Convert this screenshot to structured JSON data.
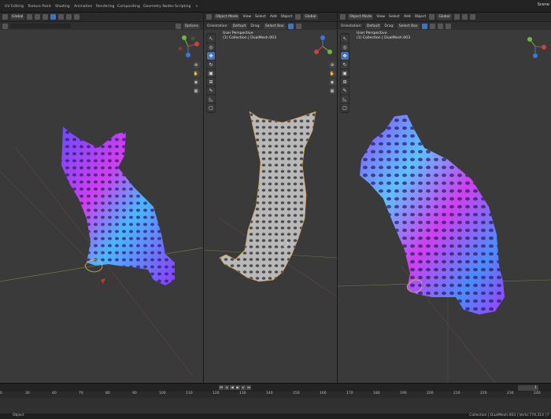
{
  "topbar": {
    "tabs": [
      "UV Editing",
      "Texture Paint",
      "Shading",
      "Animation",
      "Rendering",
      "Compositing",
      "Geometry Nodes",
      "Scripting",
      "+"
    ],
    "scene": "Scene"
  },
  "left": {
    "orientation": "Global",
    "options": "Options"
  },
  "middle": {
    "mode": "Object Mode",
    "menus": [
      "View",
      "Select",
      "Add",
      "Object"
    ],
    "transform": "Global",
    "orientation_label": "Orientation:",
    "orientation_value": "Default",
    "drag_label": "Drag:",
    "drag_value": "Select Box",
    "perspective": "User Perspective",
    "collection": "(1) Collection | DualMesh.003"
  },
  "right": {
    "mode": "Object Mode",
    "menus": [
      "View",
      "Select",
      "Add",
      "Object"
    ],
    "transform": "Global",
    "orientation_label": "Orientation:",
    "orientation_value": "Default",
    "drag_label": "Drag:",
    "drag_value": "Select Box",
    "perspective": "User Perspective",
    "collection": "(1) Collection | DualMesh.003"
  },
  "timeline": {
    "ticks": [
      "0",
      "30",
      "40",
      "70",
      "80",
      "90",
      "100",
      "110",
      "120",
      "130",
      "140",
      "150",
      "160",
      "170",
      "180",
      "190",
      "200",
      "210",
      "220",
      "230",
      "240"
    ],
    "current_frame": "1"
  },
  "status": {
    "left": "Object",
    "right": "Collection | DualMesh.003 | Verts:774,314 | F"
  },
  "colors": {
    "accent": "#4772b3",
    "viewport_bg": "#3a3a3a"
  }
}
